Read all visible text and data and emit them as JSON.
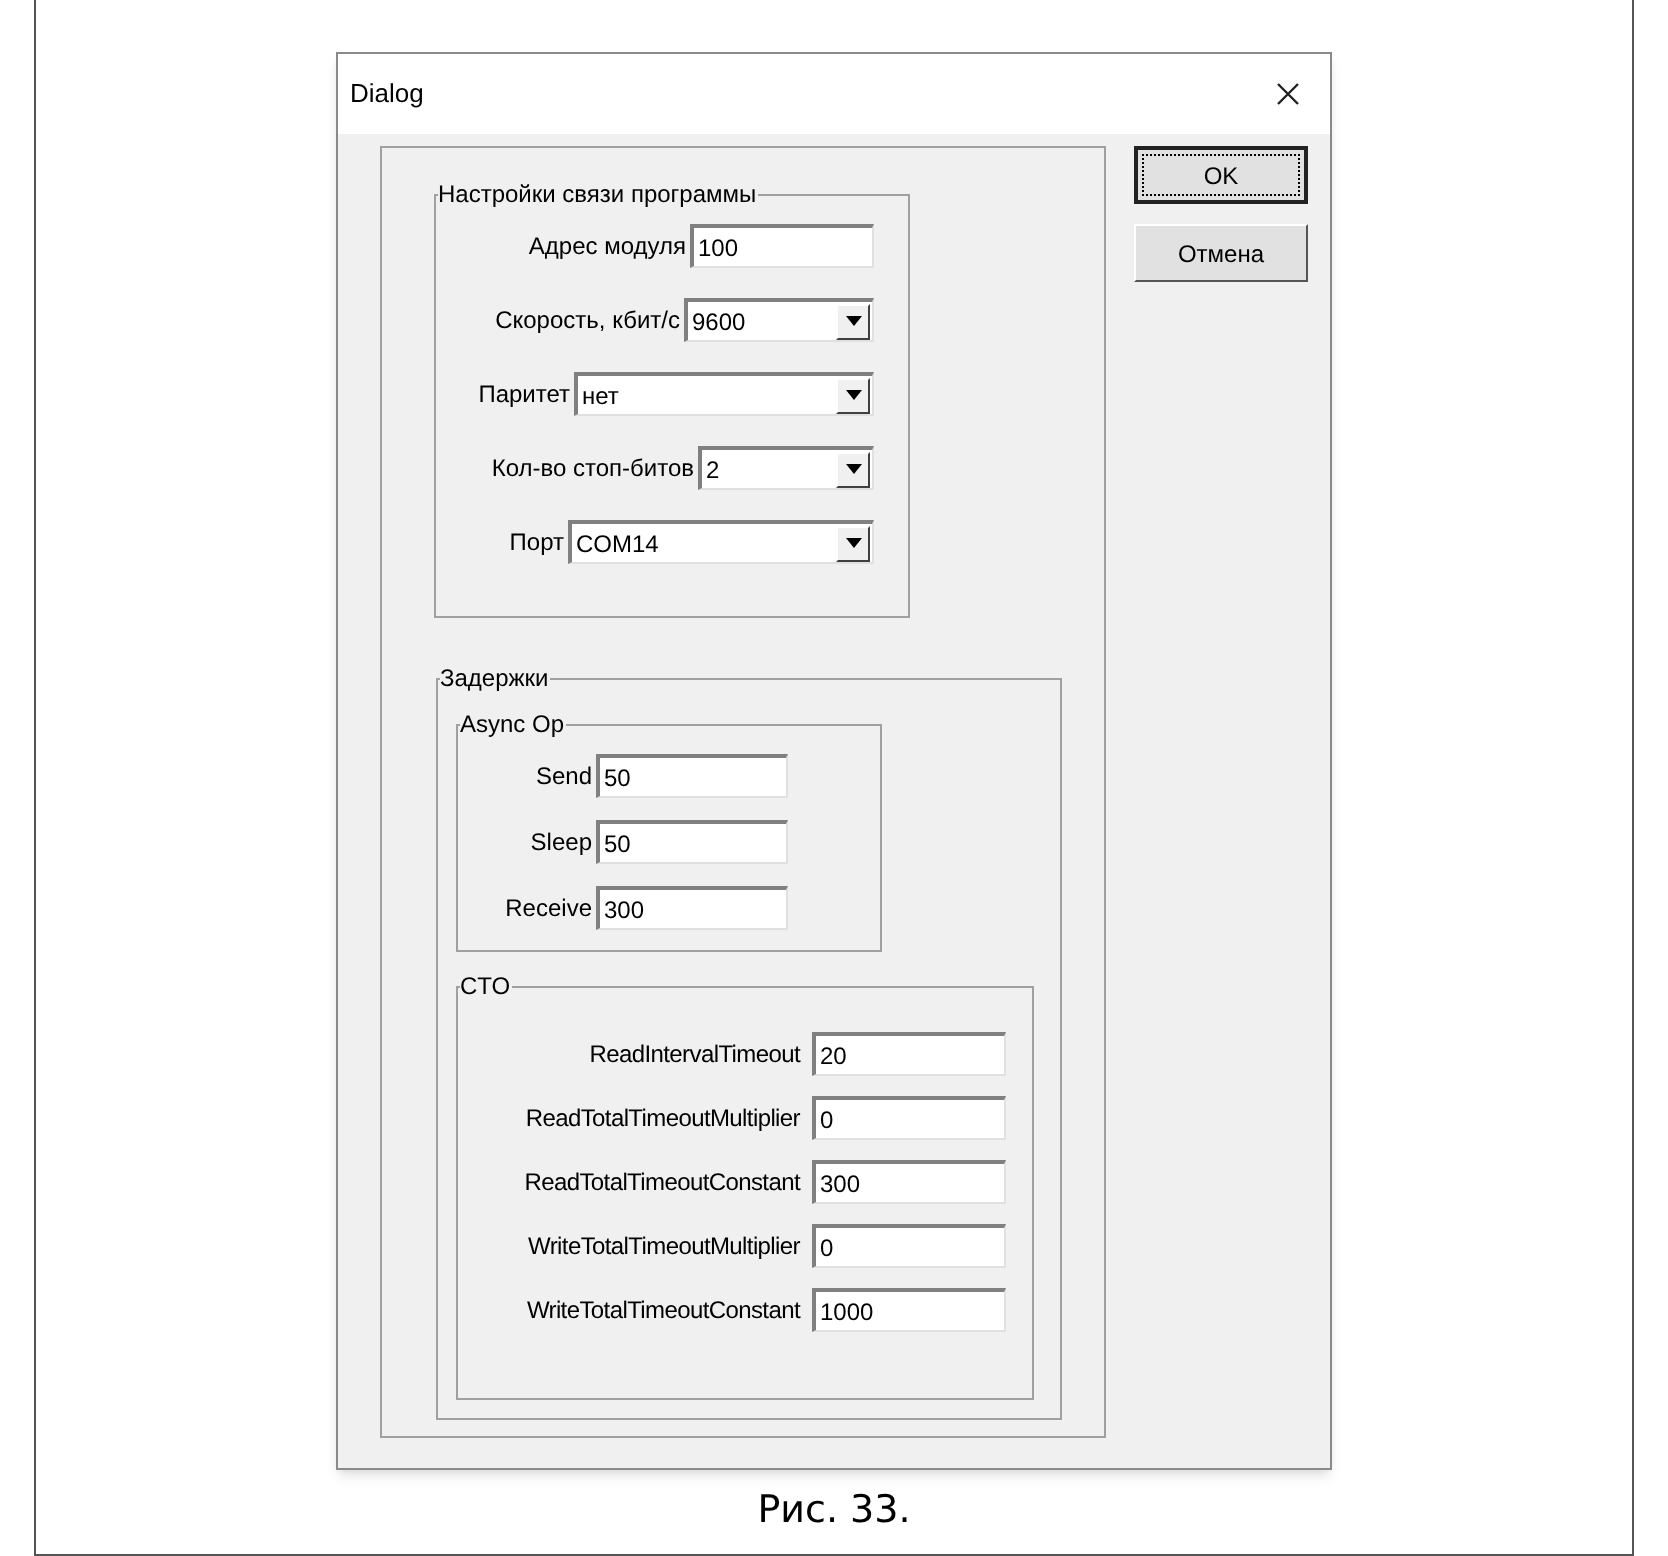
{
  "window": {
    "title": "Dialog"
  },
  "connection_group": {
    "title": "Настройки связи программы",
    "fields": [
      {
        "kind": "text",
        "label": "Адрес модуля",
        "value": "100"
      },
      {
        "kind": "dropdown",
        "label": "Скорость, кбит/с",
        "value": "9600"
      },
      {
        "kind": "dropdown",
        "label": "Паритет",
        "value": "нет"
      },
      {
        "kind": "dropdown",
        "label": "Кол-во стоп-битов",
        "value": "2"
      },
      {
        "kind": "dropdown",
        "label": "Порт",
        "value": "COM14"
      }
    ]
  },
  "delays_group": {
    "title": "Задержки",
    "async_group": {
      "title": "Async Op",
      "fields": [
        {
          "label": "Send",
          "value": "50"
        },
        {
          "label": "Sleep",
          "value": "50"
        },
        {
          "label": "Receive",
          "value": "300"
        }
      ]
    },
    "cto_group": {
      "title": "CTO",
      "fields": [
        {
          "label": "ReadIntervalTimeout",
          "value": "20"
        },
        {
          "label": "ReadTotalTimeoutMultiplier",
          "value": "0"
        },
        {
          "label": "ReadTotalTimeoutConstant",
          "value": "300"
        },
        {
          "label": "WriteTotalTimeoutMultiplier",
          "value": "0"
        },
        {
          "label": "WriteTotalTimeoutConstant",
          "value": "1000"
        }
      ]
    }
  },
  "buttons": [
    {
      "label": "OK",
      "default": true
    },
    {
      "label": "Отмена",
      "default": false
    }
  ],
  "caption": "Рис. 33."
}
